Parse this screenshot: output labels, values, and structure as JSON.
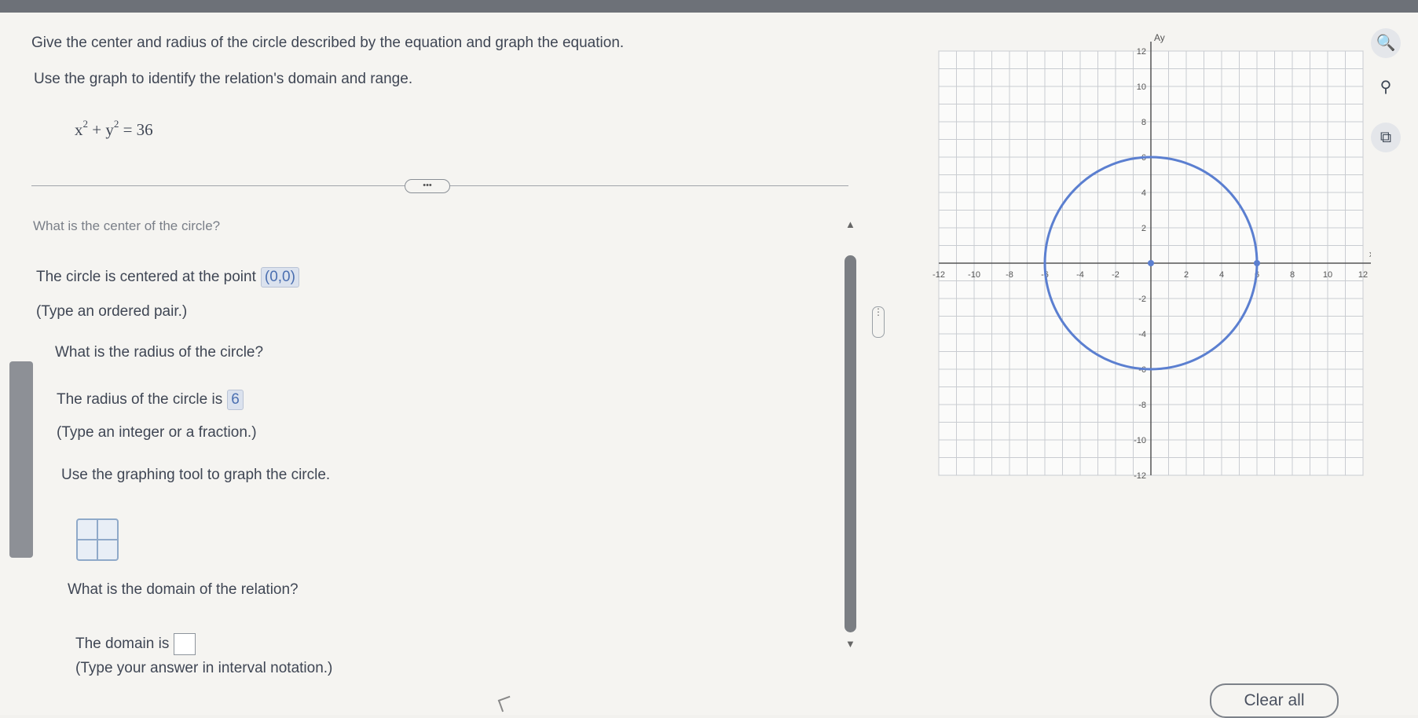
{
  "question": {
    "line1": "Give the center and radius of the circle described by the equation and graph the equation.",
    "line2": "Use the graph to identify the relation's domain and range.",
    "equation": {
      "a": "x",
      "b": "+ y",
      "c": "= 36",
      "exp": "2"
    }
  },
  "more_label": "•••",
  "center": {
    "question": "What is the center of the circle?",
    "prompt": "The circle is centered at the point",
    "answer": "(0,0)",
    "hint": "(Type an ordered pair.)"
  },
  "radius": {
    "question": "What is the radius of the circle?",
    "prompt": "The radius of the circle is",
    "answer": "6",
    "hint": "(Type an integer or a fraction.)"
  },
  "graph_instruction": "Use the graphing tool to graph the circle.",
  "domain": {
    "question": "What is the domain of the relation?",
    "prompt": "The domain is",
    "answer": "",
    "hint": "(Type your answer in interval notation.)"
  },
  "graph": {
    "x_axis_label": "x",
    "y_axis_label": "Ay",
    "x_ticks": [
      "-12",
      "-10",
      "-8",
      "-6",
      "-4",
      "-2",
      "2",
      "4",
      "6",
      "8",
      "10",
      "12"
    ],
    "y_ticks": [
      "12",
      "10",
      "8",
      "6",
      "4",
      "2",
      "-2",
      "-4",
      "-6",
      "-8",
      "-10",
      "-12"
    ],
    "circle_center": [
      0,
      0
    ],
    "circle_radius": 6,
    "range": [
      -12,
      12
    ],
    "circle_color": "#5b7fd0",
    "grid": true
  },
  "tools": {
    "zoom_in": "zoom-in-icon",
    "zoom_out": "zoom-out-icon",
    "popout": "popout-icon"
  },
  "clear_label": "Clear all"
}
